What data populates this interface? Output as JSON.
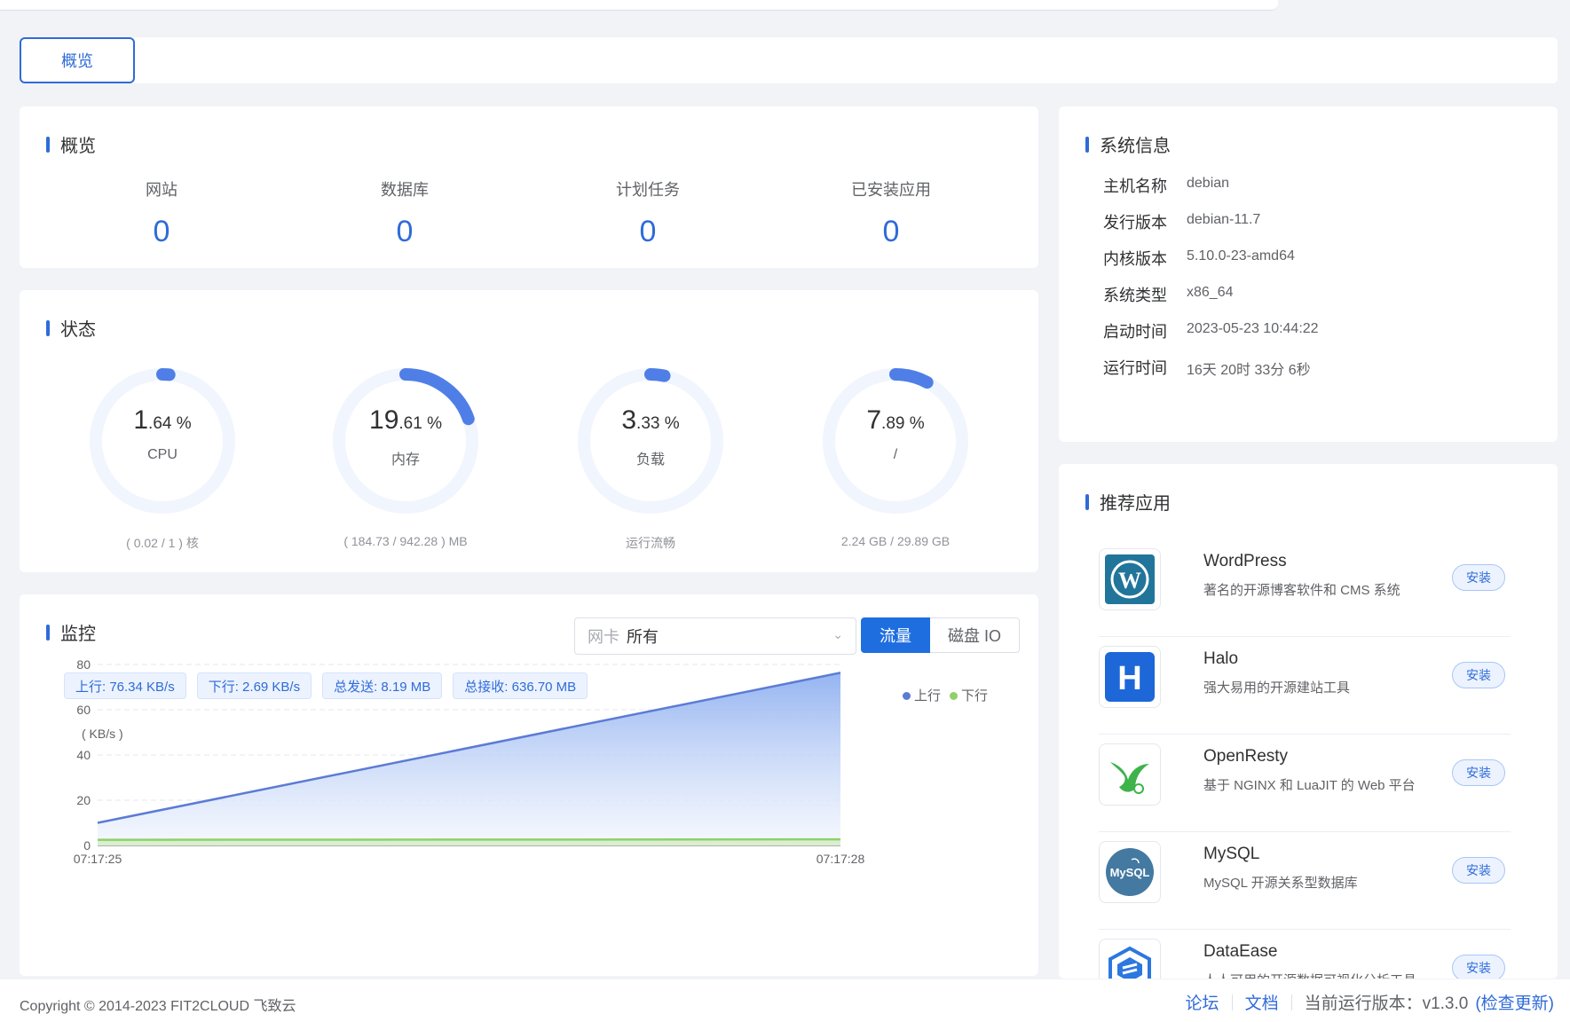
{
  "tabs": [
    {
      "label": "概览"
    }
  ],
  "overview": {
    "title": "概览",
    "items": [
      {
        "label": "网站",
        "value": "0"
      },
      {
        "label": "数据库",
        "value": "0"
      },
      {
        "label": "计划任务",
        "value": "0"
      },
      {
        "label": "已安装应用",
        "value": "0"
      }
    ]
  },
  "status": {
    "title": "状态",
    "gauges": [
      {
        "int": "1",
        "dec": ".64 %",
        "label": "CPU",
        "sub": "( 0.02 / 1 ) 核",
        "percent": 1.64
      },
      {
        "int": "19",
        "dec": ".61 %",
        "label": "内存",
        "sub": "( 184.73 / 942.28 ) MB",
        "percent": 19.61
      },
      {
        "int": "3",
        "dec": ".33 %",
        "label": "负载",
        "sub": "运行流畅",
        "percent": 3.33
      },
      {
        "int": "7",
        "dec": ".89 %",
        "label": "/",
        "sub": "2.24 GB / 29.89 GB",
        "percent": 7.89
      }
    ]
  },
  "monitor": {
    "title": "监控",
    "nic_label": "网卡",
    "nic_value": "所有",
    "buttons": {
      "traffic": "流量",
      "disk": "磁盘 IO"
    },
    "tags": [
      "上行: 76.34 KB/s",
      "下行: 2.69 KB/s",
      "总发送: 8.19 MB",
      "总接收: 636.70 MB"
    ],
    "legend": {
      "up": "上行",
      "down": "下行"
    },
    "colors": {
      "up": "#5b7bd5",
      "down": "#8fd06c"
    }
  },
  "chart_data": {
    "type": "area",
    "ylabel": "( KB/s )",
    "ylim": [
      0,
      80
    ],
    "yticks": [
      "0",
      "20",
      "40",
      "60",
      "80"
    ],
    "x": [
      "07:17:25",
      "07:17:28"
    ],
    "series": [
      {
        "name": "上行",
        "values": [
          10,
          76.34
        ]
      },
      {
        "name": "下行",
        "values": [
          2.5,
          2.69
        ]
      }
    ]
  },
  "sysinfo": {
    "title": "系统信息",
    "rows": [
      {
        "k": "主机名称",
        "v": "debian"
      },
      {
        "k": "发行版本",
        "v": "debian-11.7"
      },
      {
        "k": "内核版本",
        "v": "5.10.0-23-amd64"
      },
      {
        "k": "系统类型",
        "v": "x86_64"
      },
      {
        "k": "启动时间",
        "v": "2023-05-23 10:44:22"
      },
      {
        "k": "运行时间",
        "v": "16天 20时 33分 6秒"
      }
    ]
  },
  "apps": {
    "title": "推荐应用",
    "install_label": "安装",
    "items": [
      {
        "name": "WordPress",
        "desc": "著名的开源博客软件和 CMS 系统",
        "icon": "wordpress-icon"
      },
      {
        "name": "Halo",
        "desc": "强大易用的开源建站工具",
        "icon": "halo-icon"
      },
      {
        "name": "OpenResty",
        "desc": "基于 NGINX 和 LuaJIT 的 Web 平台",
        "icon": "openresty-icon"
      },
      {
        "name": "MySQL",
        "desc": "MySQL 开源关系型数据库",
        "icon": "mysql-icon"
      },
      {
        "name": "DataEase",
        "desc": "人人可用的开源数据可视化分析工具",
        "icon": "dataease-icon"
      }
    ]
  },
  "footer": {
    "copyright": "Copyright © 2014-2023 FIT2CLOUD 飞致云",
    "forum": "论坛",
    "docs": "文档",
    "version": "当前运行版本：v1.3.0",
    "check": "(检查更新)"
  }
}
